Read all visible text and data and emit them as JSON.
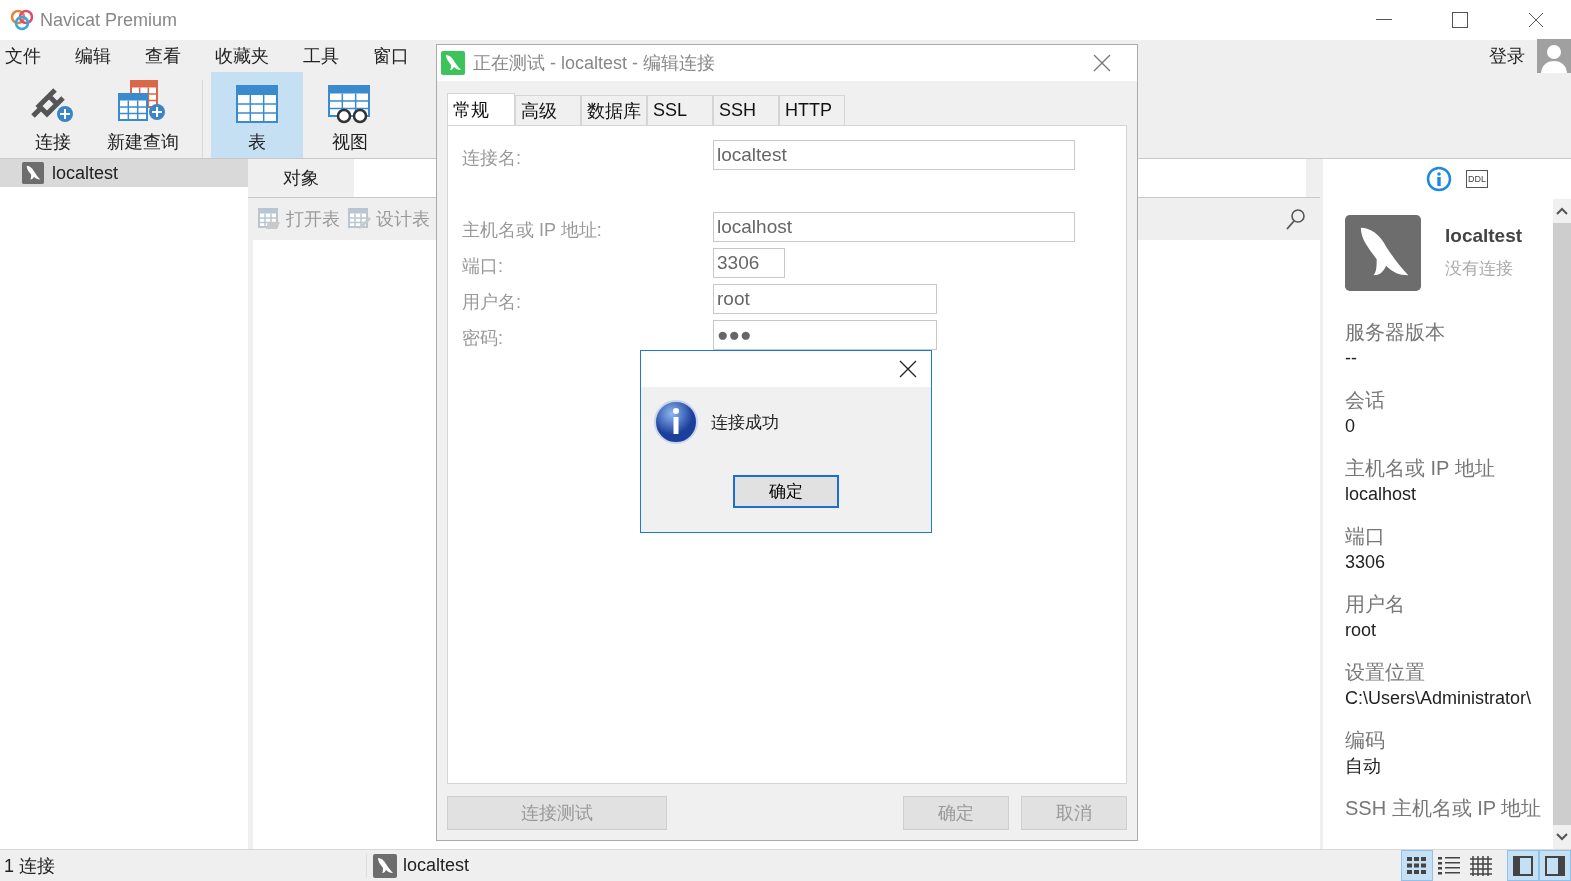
{
  "window": {
    "title": "Navicat Premium"
  },
  "menu": [
    "文件",
    "编辑",
    "查看",
    "收藏夹",
    "工具",
    "窗口"
  ],
  "account": {
    "login": "登录"
  },
  "toolbar": {
    "groups": [
      [
        {
          "label": "连接",
          "kind": "connect",
          "selected": false
        },
        {
          "label": "新建查询",
          "kind": "query",
          "selected": false
        }
      ],
      [
        {
          "label": "表",
          "kind": "table",
          "selected": true
        },
        {
          "label": "视图",
          "kind": "view",
          "selected": false
        }
      ]
    ]
  },
  "navigator": {
    "items": [
      {
        "label": "localtest",
        "selected": true
      }
    ]
  },
  "objects": {
    "tabs": [
      {
        "label": "对象",
        "selected": true
      }
    ],
    "actions": [
      {
        "label": "打开表",
        "kind": "open",
        "disabled": true
      },
      {
        "label": "设计表",
        "kind": "design",
        "disabled": true
      }
    ]
  },
  "info_panel": {
    "tabs": [
      {
        "kind": "info",
        "selected": true
      },
      {
        "kind": "ddl",
        "label": "DDL",
        "selected": false
      }
    ],
    "name": "localtest",
    "status": "没有连接",
    "properties": [
      {
        "label": "服务器版本",
        "value": "--"
      },
      {
        "label": "会话",
        "value": "0"
      },
      {
        "label": "主机名或 IP 地址",
        "value": "localhost"
      },
      {
        "label": "端口",
        "value": "3306"
      },
      {
        "label": "用户名",
        "value": "root"
      },
      {
        "label": "设置位置",
        "value": "C:\\Users\\Administrator\\"
      },
      {
        "label": "编码",
        "value": "自动"
      },
      {
        "label": "SSH 主机名或 IP 地址"
      }
    ]
  },
  "status_bar": {
    "connections": "1 连接",
    "current": "localtest",
    "views": [
      {
        "kind": "grid",
        "selected": true
      },
      {
        "kind": "list",
        "selected": false
      },
      {
        "kind": "detail",
        "selected": false
      }
    ],
    "panels": [
      {
        "kind": "left",
        "selected": true
      },
      {
        "kind": "right",
        "selected": true
      }
    ]
  },
  "dialog": {
    "title": "正在测试 - localtest - 编辑连接",
    "tabs": [
      {
        "label": "常规",
        "selected": true
      },
      {
        "label": "高级",
        "selected": false
      },
      {
        "label": "数据库",
        "selected": false
      },
      {
        "label": "SSL",
        "selected": false
      },
      {
        "label": "SSH",
        "selected": false
      },
      {
        "label": "HTTP",
        "selected": false
      }
    ],
    "fields": [
      {
        "label": "连接名:",
        "value": "localtest",
        "kind": "wide"
      },
      {
        "label": "主机名或 IP 地址:",
        "value": "localhost",
        "kind": "wide"
      },
      {
        "label": "端口:",
        "value": "3306",
        "kind": "short"
      },
      {
        "label": "用户名:",
        "value": "root",
        "kind": "medium"
      },
      {
        "label": "密码:",
        "value": "●●●",
        "kind": "medium"
      }
    ],
    "buttons": [
      {
        "label": "连接测试",
        "disabled": true
      },
      {
        "label": "确定",
        "disabled": true
      },
      {
        "label": "取消",
        "disabled": true
      }
    ]
  },
  "message_box": {
    "message": "连接成功",
    "button": "确定"
  }
}
